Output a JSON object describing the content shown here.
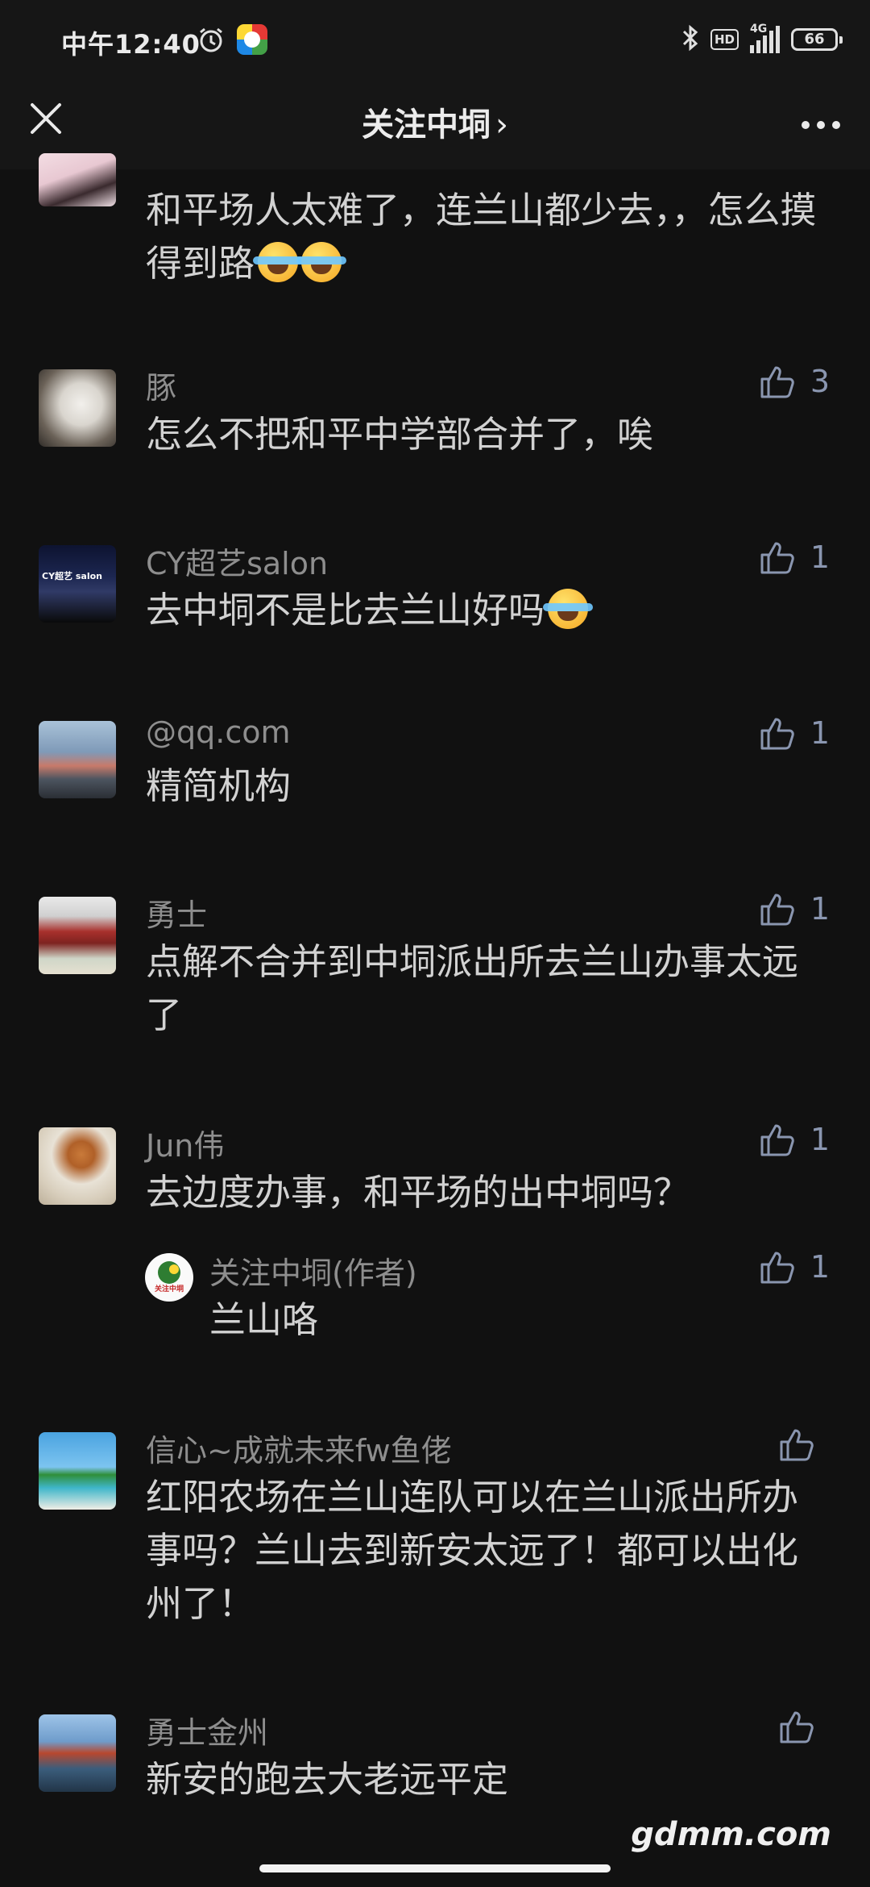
{
  "status_bar": {
    "time": "中午12:40",
    "hd": "HD",
    "network": "4G",
    "battery": "66"
  },
  "nav": {
    "title": "关注中垌",
    "chevron": "›",
    "close_icon": "close-icon",
    "more_icon": "more-icon"
  },
  "comments": [
    {
      "nickname": "",
      "text": "和平场人太难了，连兰山都少去，，怎么摸得到路",
      "likes": "",
      "emoji_count": 2
    },
    {
      "nickname": "豚",
      "text": "怎么不把和平中学部合并了，唉",
      "likes": "3"
    },
    {
      "nickname": "CY超艺salon",
      "text": "去中垌不是比去兰山好吗",
      "likes": "1",
      "emoji_count": 1
    },
    {
      "nickname": "@qq.com",
      "text": "精简机构",
      "likes": "1"
    },
    {
      "nickname": "勇士",
      "text": "点解不合并到中垌派出所去兰山办事太远了",
      "likes": "1"
    },
    {
      "nickname": "Jun伟",
      "text": "去边度办事，和平场的出中垌吗？",
      "likes": "1",
      "reply": {
        "nickname": "关注中垌(作者)",
        "text": "兰山咯",
        "likes": "1",
        "avatar_text": "关注中垌"
      }
    },
    {
      "nickname": "信心~成就未来fw鱼佬",
      "text": "红阳农场在兰山连队可以在兰山派出所办事吗？兰山去到新安太远了！都可以出化州了！",
      "likes": ""
    },
    {
      "nickname": "勇士金州",
      "text": "新安的跑去大老远平定",
      "likes": ""
    }
  ],
  "avatar_sign_text": "CY超艺 salon",
  "watermark": "gdmm.com",
  "colors": {
    "background": "#111111",
    "bar": "#161616",
    "like_icon": "#8a96b0",
    "nickname": "#8e8e8e",
    "text": "#d2d2d2"
  }
}
